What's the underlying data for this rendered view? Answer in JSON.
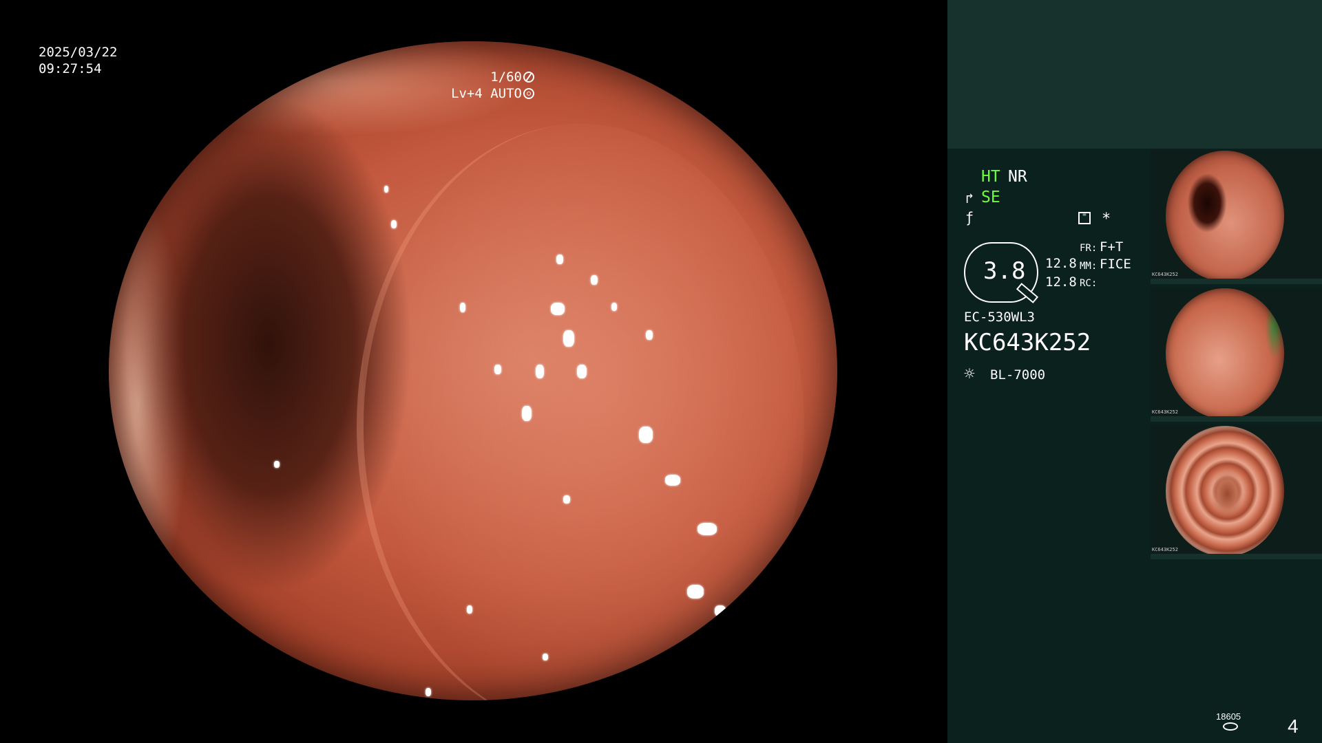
{
  "osd": {
    "date": "2025/03/22",
    "time": "09:27:54",
    "shutter": "1/60",
    "light_level": "Lv+4",
    "light_mode": "AUTO"
  },
  "panel": {
    "ht": "HT",
    "nr": "NR",
    "se": "SE",
    "magnification": "3.8",
    "enhance_1": "12.8",
    "enhance_2": "12.8",
    "fr_label": "FR:",
    "fr_value": "F+T",
    "mm_label": "MM:",
    "mm_value": "FICE",
    "rc_label": "RC:",
    "scope_model": "EC-530WL3",
    "scope_serial": "KC643K252",
    "light_source": "BL-7000",
    "frame_count": "18605",
    "page_number": "4"
  },
  "thumbnails": [
    {
      "serial": "KC643K252"
    },
    {
      "serial": "KC643K252"
    },
    {
      "serial": "KC643K252"
    }
  ],
  "colors": {
    "panel_bg": "#0b211d",
    "panel_top_bg": "#17312c",
    "status_green": "#6dff3c",
    "mucosa": "#c45a3f"
  }
}
